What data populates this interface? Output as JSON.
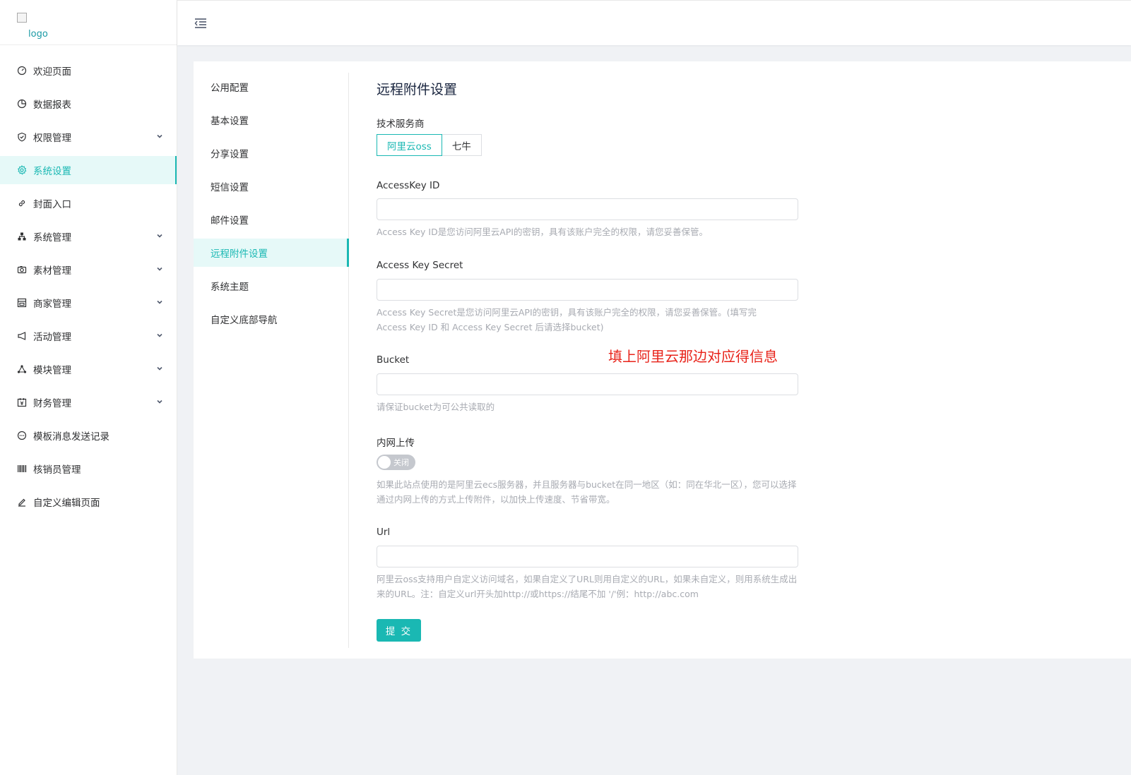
{
  "logo": {
    "alt": "logo"
  },
  "sidebar": {
    "items": [
      {
        "label": "欢迎页面",
        "icon": "dashboard-icon",
        "has_arrow": false
      },
      {
        "label": "数据报表",
        "icon": "pie-chart-icon",
        "has_arrow": false
      },
      {
        "label": "权限管理",
        "icon": "shield-icon",
        "has_arrow": true
      },
      {
        "label": "系统设置",
        "icon": "gear-icon",
        "has_arrow": false,
        "active": true
      },
      {
        "label": "封面入口",
        "icon": "link-icon",
        "has_arrow": false
      },
      {
        "label": "系统管理",
        "icon": "sitemap-icon",
        "has_arrow": true
      },
      {
        "label": "素材管理",
        "icon": "camera-icon",
        "has_arrow": true
      },
      {
        "label": "商家管理",
        "icon": "shop-icon",
        "has_arrow": true
      },
      {
        "label": "活动管理",
        "icon": "megaphone-icon",
        "has_arrow": true
      },
      {
        "label": "模块管理",
        "icon": "nodes-icon",
        "has_arrow": true
      },
      {
        "label": "财务管理",
        "icon": "finance-icon",
        "has_arrow": true
      },
      {
        "label": "模板消息发送记录",
        "icon": "message-icon",
        "has_arrow": false
      },
      {
        "label": "核销员管理",
        "icon": "barcode-icon",
        "has_arrow": false
      },
      {
        "label": "自定义编辑页面",
        "icon": "edit-icon",
        "has_arrow": false
      }
    ]
  },
  "subnav": {
    "items": [
      {
        "label": "公用配置"
      },
      {
        "label": "基本设置"
      },
      {
        "label": "分享设置"
      },
      {
        "label": "短信设置"
      },
      {
        "label": "邮件设置"
      },
      {
        "label": "远程附件设置",
        "active": true
      },
      {
        "label": "系统主题"
      },
      {
        "label": "自定义底部导航"
      }
    ]
  },
  "form": {
    "title": "远程附件设置",
    "provider": {
      "label": "技术服务商",
      "options": [
        "阿里云oss",
        "七牛"
      ],
      "selected": "阿里云oss"
    },
    "access_key_id": {
      "label": "AccessKey ID",
      "value": "",
      "help": "Access Key ID是您访问阿里云API的密钥，具有该账户完全的权限，请您妥善保管。"
    },
    "access_key_secret": {
      "label": "Access Key Secret",
      "value": "",
      "help": "Access Key Secret是您访问阿里云API的密钥，具有该账户完全的权限，请您妥善保管。(填写完Access Key ID 和 Access Key Secret 后请选择bucket)"
    },
    "bucket": {
      "label": "Bucket",
      "value": "",
      "help": "请保证bucket为可公共读取的"
    },
    "intranet": {
      "label": "内网上传",
      "switch_text": "关闭",
      "enabled": false,
      "help": "如果此站点使用的是阿里云ecs服务器，并且服务器与bucket在同一地区（如：同在华北一区），您可以选择通过内网上传的方式上传附件，以加快上传速度、节省带宽。"
    },
    "url": {
      "label": "Url",
      "value": "",
      "help": "阿里云oss支持用户自定义访问域名，如果自定义了URL则用自定义的URL，如果未自定义，则用系统生成出来的URL。注：自定义url开头加http://或https://结尾不加 '/'例：http://abc.com"
    },
    "submit_label": "提 交"
  },
  "annotation": {
    "text": "填上阿里云那边对应得信息",
    "color": "#e8231a"
  },
  "colors": {
    "accent": "#1ab8b3",
    "active_bg": "#e6f9f8"
  }
}
